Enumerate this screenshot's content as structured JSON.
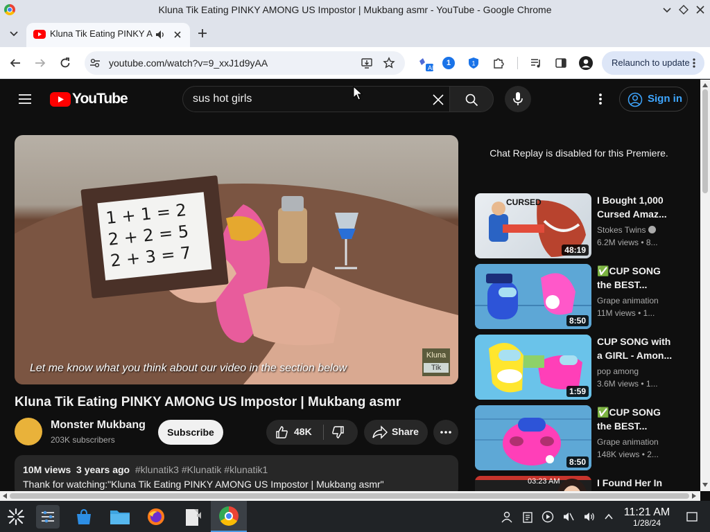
{
  "window": {
    "title": "Kluna Tik Eating PINKY AMONG US Impostor | Mukbang asmr - YouTube - Google Chrome"
  },
  "tab": {
    "label": "Kluna Tik Eating PINKY A"
  },
  "toolbar": {
    "url": "youtube.com/watch?v=9_xxJ1d9yAA",
    "relaunch_label": "Relaunch to update",
    "badge_count": "1"
  },
  "youtube": {
    "logo_text": "YouTube",
    "search_value": "sus hot girls",
    "sign_in": "Sign in"
  },
  "video": {
    "caption": "Let me know what you think about our video in the section below",
    "watermark_line1": "Kluna",
    "watermark_line2": "Tik",
    "board_line1": "1 + 1 = 2",
    "board_line2": "2 + 2 = 5",
    "board_line3": "2 + 3 = 7",
    "title": "Kluna Tik Eating PINKY AMONG US Impostor | Mukbang asmr",
    "channel": "Monster Mukbang",
    "subscribers": "203K subscribers",
    "subscribe": "Subscribe",
    "likes": "48K",
    "share": "Share",
    "views": "10M views",
    "age": "3 years ago",
    "hashtags": "#klunatik3 #Klunatik #klunatik1",
    "description": "Thank for watching:\"Kluna Tik Eating PINKY AMONG US Impostor | Mukbang asmr\""
  },
  "chat": {
    "notice": "Chat Replay is disabled for this Premiere."
  },
  "related": [
    {
      "title": "I Bought 1,000 Cursed Amaz...",
      "channel": "Stokes Twins",
      "meta": "6.2M views • 8...",
      "duration": "48:19",
      "thumb_text": "CURSED"
    },
    {
      "title": "✅CUP SONG the BEST...",
      "channel": "Grape animation",
      "meta": "11M views • 1...",
      "duration": "8:50",
      "thumb_text": ""
    },
    {
      "title": "CUP SONG with a GIRL - Amon...",
      "channel": "pop among",
      "meta": "3.6M views • 1...",
      "duration": "1:59",
      "thumb_text": ""
    },
    {
      "title": "✅CUP SONG the BEST...",
      "channel": "Grape animation",
      "meta": "148K views • 2...",
      "duration": "8:50",
      "thumb_text": ""
    },
    {
      "title": "I Found Her In",
      "channel": "",
      "meta": "",
      "duration": "",
      "thumb_text": "03:23 AM"
    }
  ],
  "taskbar": {
    "time": "11:21 AM",
    "date": "1/28/24"
  },
  "colors": {
    "yt_red": "#ff0000",
    "chrome_bg": "#dfe3eb",
    "yt_bg": "#0f0f0f",
    "link_blue": "#3ea6ff"
  }
}
